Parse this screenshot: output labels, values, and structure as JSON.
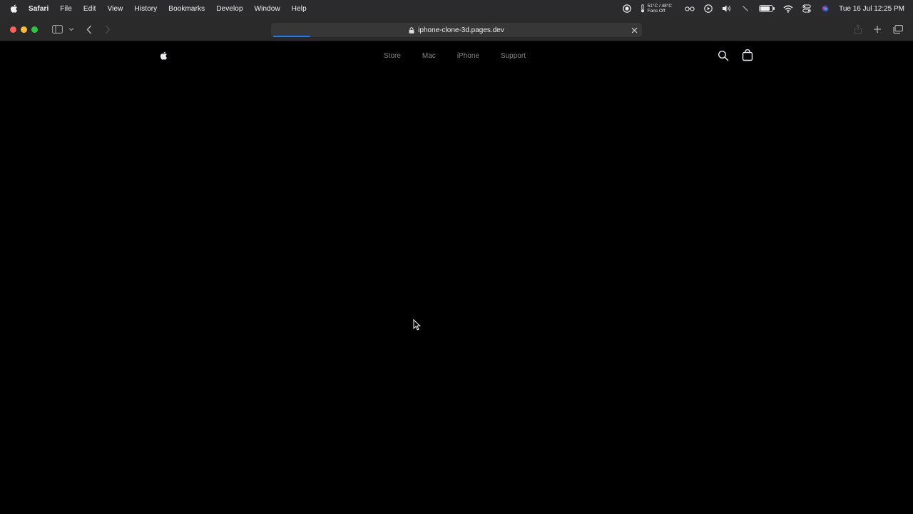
{
  "menubar": {
    "app_name": "Safari",
    "menus": [
      "File",
      "Edit",
      "View",
      "History",
      "Bookmarks",
      "Develop",
      "Window",
      "Help"
    ],
    "temp_line1": "51°C / 48°C",
    "temp_line2": "Fans Off",
    "clock": "Tue 16 Jul  12:25 PM",
    "battery_level": 0.8
  },
  "browser": {
    "url": "iphone-clone-3d.pages.dev",
    "loading_progress": 0.1,
    "accent_color": "#1f7bf6"
  },
  "site_nav": {
    "links": [
      "Store",
      "Mac",
      "iPhone",
      "Support"
    ],
    "link_color": "#86868b",
    "background": "#000000"
  },
  "icons": {
    "menubar": [
      "apple-logo-icon",
      "record-icon",
      "thermometer-icon",
      "glasses-icon",
      "play-circle-icon",
      "volume-icon",
      "pen-icon",
      "battery-icon",
      "wifi-icon",
      "control-center-icon",
      "siri-icon"
    ],
    "toolbar": [
      "sidebar-icon",
      "chevron-down-icon",
      "back-icon",
      "forward-icon",
      "lock-icon",
      "close-icon",
      "share-icon",
      "new-tab-icon",
      "tab-overview-icon"
    ],
    "site": [
      "apple-logo-icon",
      "search-icon",
      "bag-icon"
    ]
  }
}
